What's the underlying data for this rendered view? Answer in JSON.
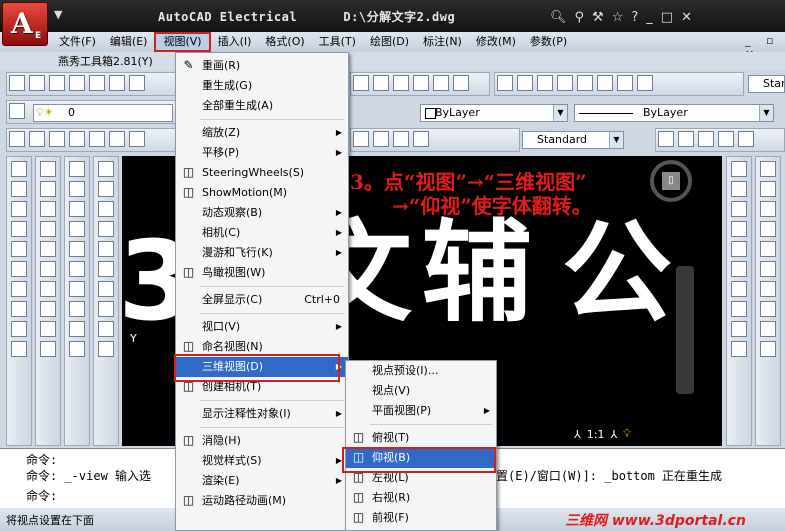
{
  "title": {
    "app": "AutoCAD Electrical",
    "file": "D:\\分解文字2.dwg"
  },
  "app_button": {
    "letter": "A",
    "edition": "E"
  },
  "menubar": [
    "文件(F)",
    "编辑(E)",
    "视图(V)",
    "插入(I)",
    "格式(O)",
    "工具(T)",
    "绘图(D)",
    "标注(N)",
    "修改(M)",
    "参数(P)"
  ],
  "toolbox_label": "燕秀工具箱2.81(Y)",
  "window_controls": "_ ▫ ×",
  "toolbar": {
    "layer_value": "0",
    "color_value": "ByLayer",
    "linetype_value": "ByLayer",
    "dim_style": "Standard",
    "text_style_partial": "Stan"
  },
  "view_menu": [
    {
      "label": "重画(R)",
      "icon": "pencil-icon"
    },
    {
      "label": "重生成(G)"
    },
    {
      "label": "全部重生成(A)"
    },
    {
      "sep": true
    },
    {
      "label": "缩放(Z)",
      "submenu": true
    },
    {
      "label": "平移(P)",
      "submenu": true
    },
    {
      "label": "SteeringWheels(S)",
      "icon": "steering-wheel-icon"
    },
    {
      "label": "ShowMotion(M)",
      "icon": "showmotion-icon"
    },
    {
      "label": "动态观察(B)",
      "submenu": true
    },
    {
      "label": "相机(C)",
      "submenu": true
    },
    {
      "label": "漫游和飞行(K)",
      "submenu": true
    },
    {
      "label": "鸟瞰视图(W)",
      "icon": "aerial-view-icon"
    },
    {
      "sep": true
    },
    {
      "label": "全屏显示(C)",
      "shortcut": "Ctrl+0"
    },
    {
      "sep": true
    },
    {
      "label": "视口(V)",
      "submenu": true
    },
    {
      "label": "命名视图(N)",
      "icon": "named-view-icon"
    },
    {
      "label": "三维视图(D)",
      "submenu": true,
      "highlight": true
    },
    {
      "label": "创建相机(T)",
      "icon": "camera-icon"
    },
    {
      "sep": true
    },
    {
      "label": "显示注释性对象(I)",
      "submenu": true
    },
    {
      "sep": true
    },
    {
      "label": "消隐(H)",
      "icon": "hide-icon"
    },
    {
      "label": "视觉样式(S)",
      "submenu": true
    },
    {
      "label": "渲染(E)",
      "submenu": true
    },
    {
      "label": "运动路径动画(M)",
      "icon": "motion-path-icon"
    }
  ],
  "submenu_3d": [
    {
      "label": "视点预设(I)..."
    },
    {
      "label": "视点(V)"
    },
    {
      "label": "平面视图(P)",
      "submenu": true
    },
    {
      "sep": true
    },
    {
      "label": "俯视(T)",
      "icon": "top-view-icon"
    },
    {
      "label": "仰视(B)",
      "icon": "bottom-view-icon",
      "highlight": true
    },
    {
      "label": "左视(L)",
      "icon": "left-view-icon"
    },
    {
      "label": "右视(R)",
      "icon": "right-view-icon"
    },
    {
      "label": "前视(F)",
      "icon": "front-view-icon"
    }
  ],
  "canvas": {
    "instruction_line1": "3。点“视图”→“三维视图”",
    "instruction_line2": "→“仰视”使字体翻转。",
    "big_text": [
      "3",
      "文",
      "辅",
      "公"
    ],
    "ucs_label": "Y",
    "scale_label": "1:1"
  },
  "command": {
    "line1": "命令:",
    "line2_left": "命令: _-view 输入选",
    "line2_right": "置(E)/窗口(W)]: _bottom 正在重生成",
    "line3": "命令:"
  },
  "status_text": "将视点设置在下面",
  "watermark": "三维网 www.3dportal.cn",
  "colors": {
    "accent_red": "#d02020",
    "highlight_blue": "#3169c6",
    "annotation_red": "#e21b1b"
  }
}
